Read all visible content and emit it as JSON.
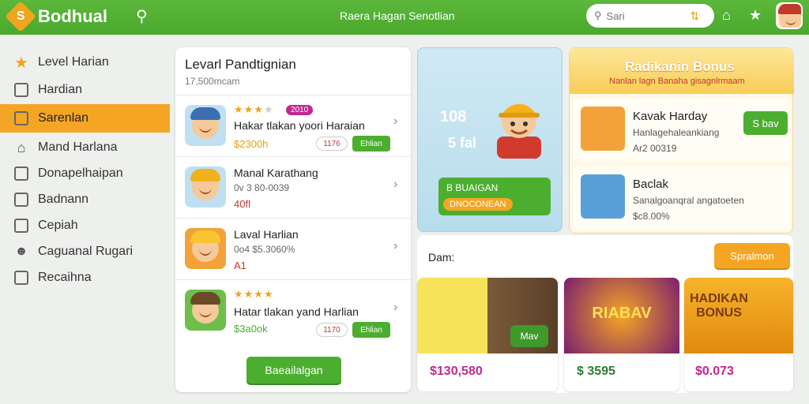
{
  "header": {
    "app_name": "Bodhual",
    "center_title": "Raera Hagan Senotlian",
    "search_placeholder": "Sari"
  },
  "sidebar": {
    "items": [
      {
        "label": "Level Harian",
        "icon": "star-icon"
      },
      {
        "label": "Hardian",
        "icon": "square-icon"
      },
      {
        "label": "Sarenlan",
        "icon": "flag-icon",
        "active": true
      },
      {
        "label": "Mand Harlana",
        "icon": "home-icon"
      },
      {
        "label": "Donapelhaipan",
        "icon": "box-icon"
      },
      {
        "label": "Badnann",
        "icon": "edit-icon"
      },
      {
        "label": "Cepiah",
        "icon": "list-icon"
      },
      {
        "label": "Caguanal Rugari",
        "icon": "user-icon"
      },
      {
        "label": "Recaihna",
        "icon": "chat-icon"
      }
    ]
  },
  "list": {
    "title": "Levarl Pandtignian",
    "subtitle": "17,500mcam",
    "rows": [
      {
        "name": "Hakar tlakan yoori Haraian",
        "price": "$2300h",
        "badge": "2010",
        "qty": "1176",
        "btn": "Ehlian",
        "stars": 3
      },
      {
        "name": "Manal Karathang",
        "sub": "0v 3 80-0039",
        "price": "40fl"
      },
      {
        "name": "Laval Harlian",
        "sub": "0o4 $5.3060%",
        "price": "A1"
      },
      {
        "name": "Hatar tlakan yand Harlian",
        "price": "$3a0ok",
        "qty": "1170",
        "btn": "Ehlian",
        "stars": 4
      }
    ],
    "bottom_button": "Baeailalgan"
  },
  "hero": {
    "num1": "108",
    "num2": "5 fal",
    "btn_line1": "B BUAIGAN",
    "btn_line2": "DNOCONEAN"
  },
  "bonus": {
    "title": "Radikanin Bonus",
    "subtitle": "Nanlan lagn Banaha gisagnlrmaam",
    "offers": [
      {
        "title": "Kavak Harday",
        "sub": "Hanlagehaleankiang",
        "val": "Ar2 00319",
        "btn": "S bav"
      },
      {
        "title": "Baclak",
        "sub": "Sanalgoanqral angatoeten",
        "val": "$c8.00%"
      }
    ]
  },
  "promo": {
    "label": "Dam:",
    "button": "Spralmon",
    "tiles": [
      {
        "price": "$130,580",
        "btn": "Mav"
      },
      {
        "price": "$ 3595",
        "word": "RIABAV"
      },
      {
        "price": "$0.073",
        "word": "HADIKAN BONUS"
      }
    ]
  },
  "colors": {
    "green": "#4cae2f",
    "orange": "#f5a524",
    "pink": "#c3278f"
  }
}
